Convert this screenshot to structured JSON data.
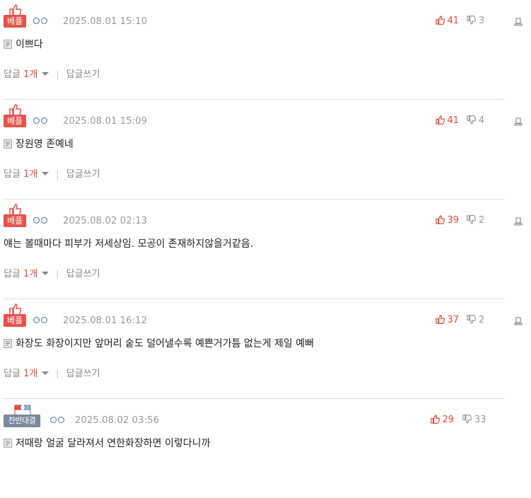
{
  "colors": {
    "accent": "#e04a3a",
    "best_badge": "#e8524a",
    "debate_badge": "#7a8a9c",
    "ring": "#4a6fa5"
  },
  "comments": [
    {
      "badge": "베플",
      "badge_type": "best",
      "date": "2025.08.01 15:10",
      "up": "41",
      "down": "3",
      "text": "이쁘다",
      "reply_label": "답글",
      "reply_count": "1개",
      "write_label": "답글쓰기"
    },
    {
      "badge": "베플",
      "badge_type": "best",
      "date": "2025.08.01 15:09",
      "up": "41",
      "down": "4",
      "text": "장원영 존예네",
      "reply_label": "답글",
      "reply_count": "1개",
      "write_label": "답글쓰기"
    },
    {
      "badge": "베플",
      "badge_type": "best",
      "date": "2025.08.02 02:13",
      "up": "39",
      "down": "2",
      "text": "얘는 볼때마다 피부가 저세상임. 모공이 존재하지않을거같음.",
      "reply_label": "답글",
      "reply_count": "1개",
      "write_label": "답글쓰기"
    },
    {
      "badge": "베플",
      "badge_type": "best",
      "date": "2025.08.01 16:12",
      "up": "37",
      "down": "2",
      "text": "화장도 화장이지만 앞머리 숱도 덜어낼수록 예쁜거가틈 없는게 제일 예뻐",
      "reply_label": "답글",
      "reply_count": "1개",
      "write_label": "답글쓰기"
    },
    {
      "badge": "찬반대결",
      "badge_type": "debate",
      "date": "2025.08.02 03:56",
      "up": "29",
      "down": "33",
      "text": "저때랑 얼굴 달라져서 연한화장하면 이렇다니까"
    }
  ]
}
